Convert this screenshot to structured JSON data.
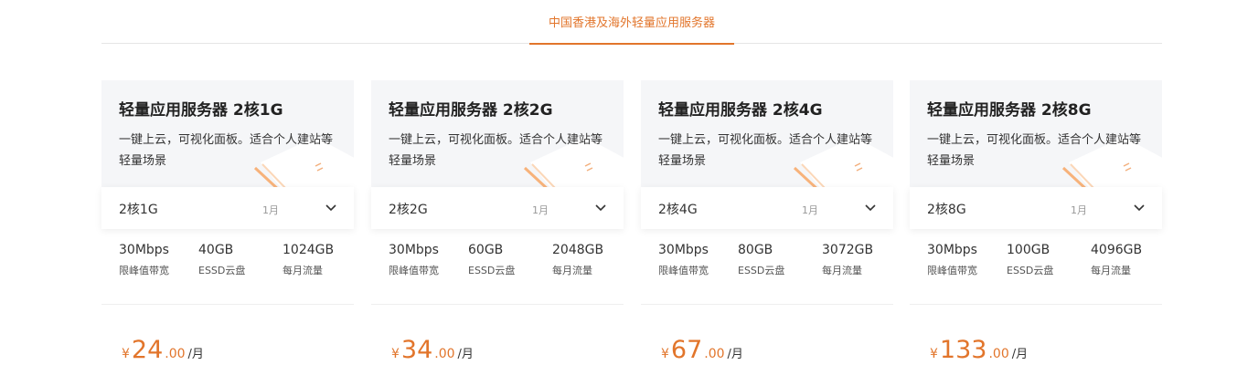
{
  "tabs": [
    {
      "label": "中国香港及海外轻量应用服务器",
      "active": true
    }
  ],
  "colors": {
    "accent": "#e2752b",
    "card_bg": "#f5f6f8",
    "text": "#333333",
    "muted": "#999999"
  },
  "products": [
    {
      "title": "轻量应用服务器 2核1G",
      "desc": "一键上云，可视化面板。适合个人建站等轻量场景",
      "config": "2核1G",
      "period": "1月",
      "specs": [
        {
          "value": "30Mbps",
          "label": "限峰值带宽"
        },
        {
          "value": "40GB",
          "label": "ESSD云盘"
        },
        {
          "value": "1024GB",
          "label": "每月流量"
        }
      ],
      "price": {
        "currency": "¥",
        "integer": "24",
        "decimal": ".00",
        "unit": "/月"
      }
    },
    {
      "title": "轻量应用服务器 2核2G",
      "desc": "一键上云，可视化面板。适合个人建站等轻量场景",
      "config": "2核2G",
      "period": "1月",
      "specs": [
        {
          "value": "30Mbps",
          "label": "限峰值带宽"
        },
        {
          "value": "60GB",
          "label": "ESSD云盘"
        },
        {
          "value": "2048GB",
          "label": "每月流量"
        }
      ],
      "price": {
        "currency": "¥",
        "integer": "34",
        "decimal": ".00",
        "unit": "/月"
      }
    },
    {
      "title": "轻量应用服务器 2核4G",
      "desc": "一键上云，可视化面板。适合个人建站等轻量场景",
      "config": "2核4G",
      "period": "1月",
      "specs": [
        {
          "value": "30Mbps",
          "label": "限峰值带宽"
        },
        {
          "value": "80GB",
          "label": "ESSD云盘"
        },
        {
          "value": "3072GB",
          "label": "每月流量"
        }
      ],
      "price": {
        "currency": "¥",
        "integer": "67",
        "decimal": ".00",
        "unit": "/月"
      }
    },
    {
      "title": "轻量应用服务器 2核8G",
      "desc": "一键上云，可视化面板。适合个人建站等轻量场景",
      "config": "2核8G",
      "period": "1月",
      "specs": [
        {
          "value": "30Mbps",
          "label": "限峰值带宽"
        },
        {
          "value": "100GB",
          "label": "ESSD云盘"
        },
        {
          "value": "4096GB",
          "label": "每月流量"
        }
      ],
      "price": {
        "currency": "¥",
        "integer": "133",
        "decimal": ".00",
        "unit": "/月"
      }
    }
  ]
}
